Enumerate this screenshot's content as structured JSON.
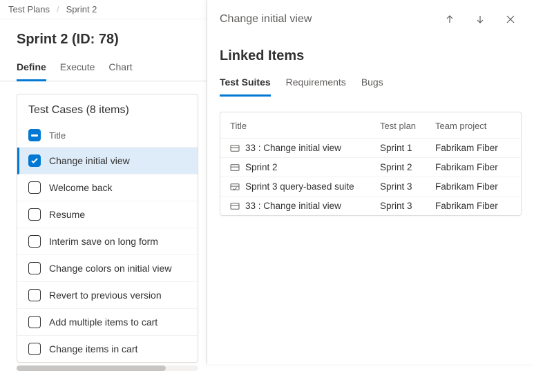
{
  "breadcrumb": {
    "root": "Test Plans",
    "current": "Sprint 2"
  },
  "page": {
    "title": "Sprint 2 (ID: 78)"
  },
  "tabs": [
    {
      "label": "Define",
      "active": true
    },
    {
      "label": "Execute",
      "active": false
    },
    {
      "label": "Chart",
      "active": false
    }
  ],
  "testcases": {
    "title": "Test Cases (8 items)",
    "header": "Title",
    "items": [
      {
        "title": "Change initial view",
        "selected": true,
        "checked": true
      },
      {
        "title": "Welcome back"
      },
      {
        "title": "Resume"
      },
      {
        "title": "Interim save on long form"
      },
      {
        "title": "Change colors on initial view"
      },
      {
        "title": "Revert to previous version"
      },
      {
        "title": "Add multiple items to cart"
      },
      {
        "title": "Change items in cart"
      }
    ]
  },
  "panel": {
    "title": "Change initial view",
    "section": "Linked Items",
    "tabs": [
      {
        "label": "Test Suites",
        "active": true
      },
      {
        "label": "Requirements"
      },
      {
        "label": "Bugs"
      }
    ],
    "columns": {
      "title": "Title",
      "plan": "Test plan",
      "team": "Team project"
    },
    "rows": [
      {
        "icon": "static",
        "title": "33 : Change initial view",
        "plan": "Sprint 1",
        "team": "Fabrikam Fiber"
      },
      {
        "icon": "static",
        "title": "Sprint 2",
        "plan": "Sprint 2",
        "team": "Fabrikam Fiber"
      },
      {
        "icon": "query",
        "title": "Sprint 3 query-based suite",
        "plan": "Sprint 3",
        "team": "Fabrikam Fiber"
      },
      {
        "icon": "static",
        "title": "33 : Change initial view",
        "plan": "Sprint 3",
        "team": "Fabrikam Fiber"
      }
    ]
  }
}
